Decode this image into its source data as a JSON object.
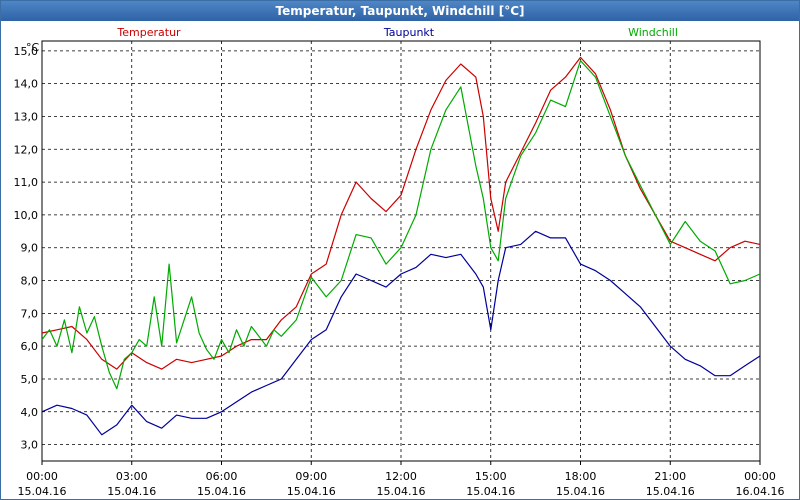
{
  "window": {
    "title": "Temperatur, Taupunkt, Windchill [°C]"
  },
  "chart_data": {
    "type": "line",
    "title": "Temperatur, Taupunkt, Windchill [°C]",
    "ylabel": "°C",
    "xlim": [
      0,
      24
    ],
    "ylim": [
      2.5,
      15.3
    ],
    "grid": true,
    "legend_position": "top",
    "y_ticks": [
      3.0,
      4.0,
      5.0,
      6.0,
      7.0,
      8.0,
      9.0,
      10.0,
      11.0,
      12.0,
      13.0,
      14.0,
      15.0
    ],
    "y_tick_labels": [
      "3,0",
      "4,0",
      "5,0",
      "6,0",
      "7,0",
      "8,0",
      "9,0",
      "10,0",
      "11,0",
      "12,0",
      "13,0",
      "14,0",
      "15,0"
    ],
    "x_ticks": [
      0,
      3,
      6,
      9,
      12,
      15,
      18,
      21,
      24
    ],
    "x_tick_times": [
      "00:00",
      "03:00",
      "06:00",
      "09:00",
      "12:00",
      "15:00",
      "18:00",
      "21:00",
      "00:00"
    ],
    "x_tick_dates": [
      "15.04.16",
      "15.04.16",
      "15.04.16",
      "15.04.16",
      "15.04.16",
      "15.04.16",
      "15.04.16",
      "15.04.16",
      "16.04.16"
    ],
    "series": [
      {
        "name": "Temperatur",
        "color": "#cc0000",
        "x": [
          0,
          0.5,
          1.0,
          1.5,
          2.0,
          2.5,
          3.0,
          3.5,
          4.0,
          4.5,
          5.0,
          5.5,
          6.0,
          6.5,
          7.0,
          7.5,
          8.0,
          8.5,
          9.0,
          9.5,
          10.0,
          10.5,
          11.0,
          11.5,
          12.0,
          12.5,
          13.0,
          13.5,
          14.0,
          14.5,
          14.75,
          15.0,
          15.25,
          15.5,
          16.0,
          16.5,
          17.0,
          17.5,
          18.0,
          18.5,
          19.0,
          19.5,
          20.0,
          20.5,
          21.0,
          21.5,
          22.0,
          22.5,
          23.0,
          23.5,
          24.0
        ],
        "values": [
          6.4,
          6.5,
          6.6,
          6.2,
          5.6,
          5.3,
          5.8,
          5.5,
          5.3,
          5.6,
          5.5,
          5.6,
          5.7,
          6.0,
          6.2,
          6.2,
          6.8,
          7.2,
          8.2,
          8.5,
          10.0,
          11.0,
          10.5,
          10.1,
          10.6,
          12.0,
          13.2,
          14.1,
          14.6,
          14.2,
          13.0,
          10.5,
          9.5,
          11.0,
          11.9,
          12.8,
          13.8,
          14.2,
          14.8,
          14.3,
          13.2,
          11.8,
          10.8,
          10.0,
          9.2,
          9.0,
          8.8,
          8.6,
          9.0,
          9.2,
          9.1
        ]
      },
      {
        "name": "Taupunkt",
        "color": "#000099",
        "x": [
          0,
          0.5,
          1.0,
          1.5,
          2.0,
          2.5,
          3.0,
          3.5,
          4.0,
          4.5,
          5.0,
          5.5,
          6.0,
          6.5,
          7.0,
          7.5,
          8.0,
          8.5,
          9.0,
          9.5,
          10.0,
          10.5,
          11.0,
          11.5,
          12.0,
          12.5,
          13.0,
          13.5,
          14.0,
          14.5,
          14.75,
          15.0,
          15.25,
          15.5,
          16.0,
          16.5,
          17.0,
          17.5,
          18.0,
          18.5,
          19.0,
          19.5,
          20.0,
          20.5,
          21.0,
          21.5,
          22.0,
          22.5,
          23.0,
          23.5,
          24.0
        ],
        "values": [
          4.0,
          4.2,
          4.1,
          3.9,
          3.3,
          3.6,
          4.2,
          3.7,
          3.5,
          3.9,
          3.8,
          3.8,
          4.0,
          4.3,
          4.6,
          4.8,
          5.0,
          5.6,
          6.2,
          6.5,
          7.5,
          8.2,
          8.0,
          7.8,
          8.2,
          8.4,
          8.8,
          8.7,
          8.8,
          8.2,
          7.8,
          6.5,
          8.0,
          9.0,
          9.1,
          9.5,
          9.3,
          9.3,
          8.5,
          8.3,
          8.0,
          7.6,
          7.2,
          6.6,
          6.0,
          5.6,
          5.4,
          5.1,
          5.1,
          5.4,
          5.7
        ]
      },
      {
        "name": "Windchill",
        "color": "#00aa00",
        "x": [
          0,
          0.25,
          0.5,
          0.75,
          1.0,
          1.25,
          1.5,
          1.75,
          2.0,
          2.25,
          2.5,
          2.75,
          3.0,
          3.25,
          3.5,
          3.75,
          4.0,
          4.25,
          4.5,
          4.75,
          5.0,
          5.25,
          5.5,
          5.75,
          6.0,
          6.25,
          6.5,
          6.75,
          7.0,
          7.25,
          7.5,
          7.75,
          8.0,
          8.5,
          9.0,
          9.5,
          10.0,
          10.5,
          11.0,
          11.5,
          12.0,
          12.5,
          13.0,
          13.5,
          14.0,
          14.5,
          14.75,
          15.0,
          15.25,
          15.5,
          16.0,
          16.5,
          17.0,
          17.5,
          18.0,
          18.5,
          19.0,
          19.5,
          20.0,
          20.5,
          21.0,
          21.5,
          22.0,
          22.5,
          23.0,
          23.5,
          24.0
        ],
        "values": [
          6.2,
          6.5,
          6.0,
          6.8,
          5.8,
          7.2,
          6.4,
          6.9,
          6.0,
          5.2,
          4.7,
          5.6,
          5.8,
          6.2,
          6.0,
          7.5,
          6.0,
          8.5,
          6.1,
          6.8,
          7.5,
          6.4,
          5.9,
          5.6,
          6.2,
          5.8,
          6.5,
          6.0,
          6.6,
          6.3,
          6.0,
          6.5,
          6.3,
          6.8,
          8.1,
          7.5,
          8.0,
          9.4,
          9.3,
          8.5,
          9.0,
          10.0,
          12.0,
          13.2,
          13.9,
          11.5,
          10.5,
          9.0,
          8.6,
          10.5,
          11.8,
          12.5,
          13.5,
          13.3,
          14.7,
          14.2,
          13.0,
          11.8,
          10.9,
          10.0,
          9.1,
          9.8,
          9.2,
          8.9,
          7.9,
          8.0,
          8.2
        ]
      }
    ]
  }
}
